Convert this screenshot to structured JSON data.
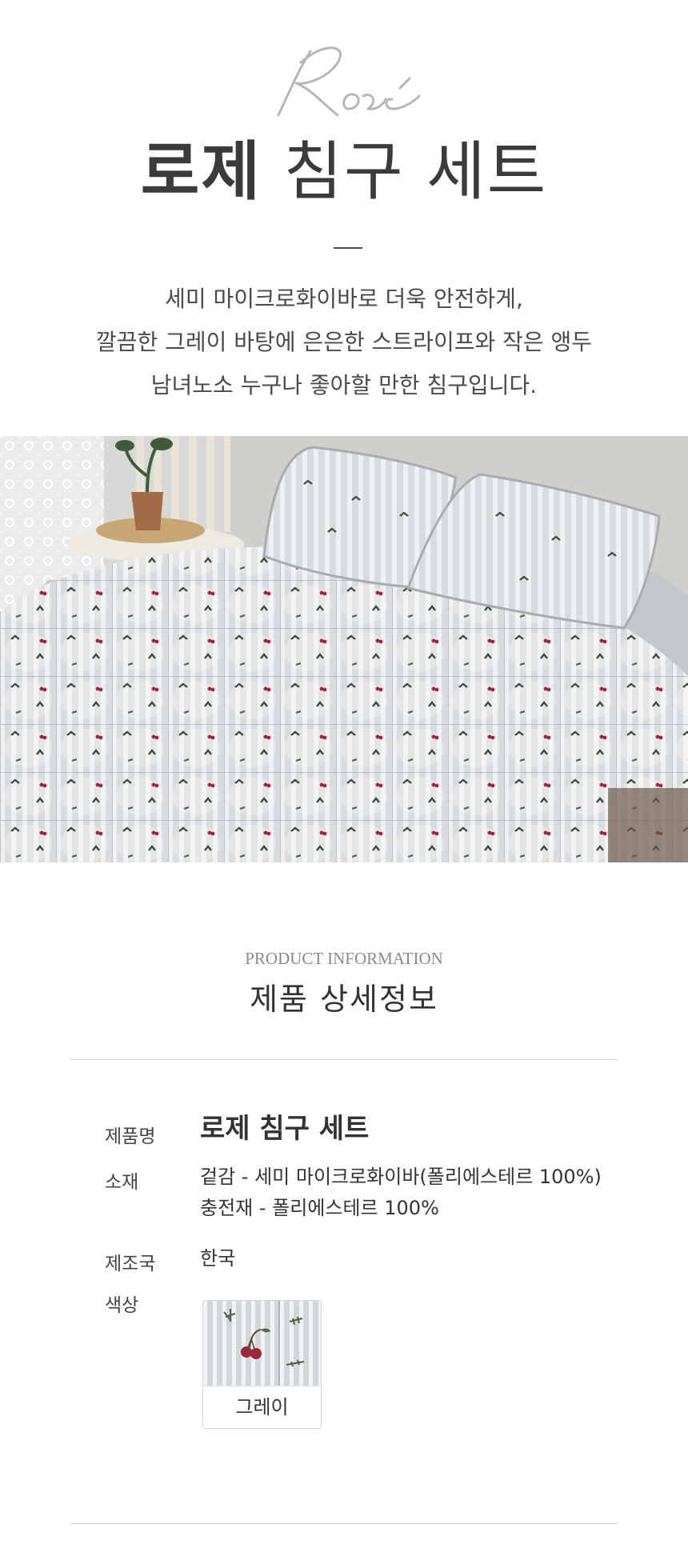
{
  "hero": {
    "logo_text": "Rosé",
    "title_bold": "로제",
    "title_light": "침구 세트",
    "intro_lines": [
      "세미 마이크로화이바로 더욱 안전하게,",
      "깔끔한 그레이 바탕에 은은한 스트라이프와 작은 앵두",
      "남녀노소 누구나 좋아할 만한 침구입니다."
    ]
  },
  "info": {
    "eng_heading": "PRODUCT INFORMATION",
    "ko_heading": "제품 상세정보",
    "rows": [
      {
        "label": "제품명",
        "values": [
          "로제 침구 세트"
        ]
      },
      {
        "label": "소재",
        "values": [
          "겉감 - 세미 마이크로화이바(폴리에스테르 100%)",
          "충전재 - 폴리에스테르 100%"
        ]
      },
      {
        "label": "제조국",
        "values": [
          "한국"
        ]
      },
      {
        "label": "색상",
        "values": []
      }
    ],
    "color_option": "그레이"
  },
  "colors": {
    "text_dark": "#3b3b3b",
    "fabric_gray": "#c8ccd0",
    "cherry_red": "#a3253a"
  }
}
